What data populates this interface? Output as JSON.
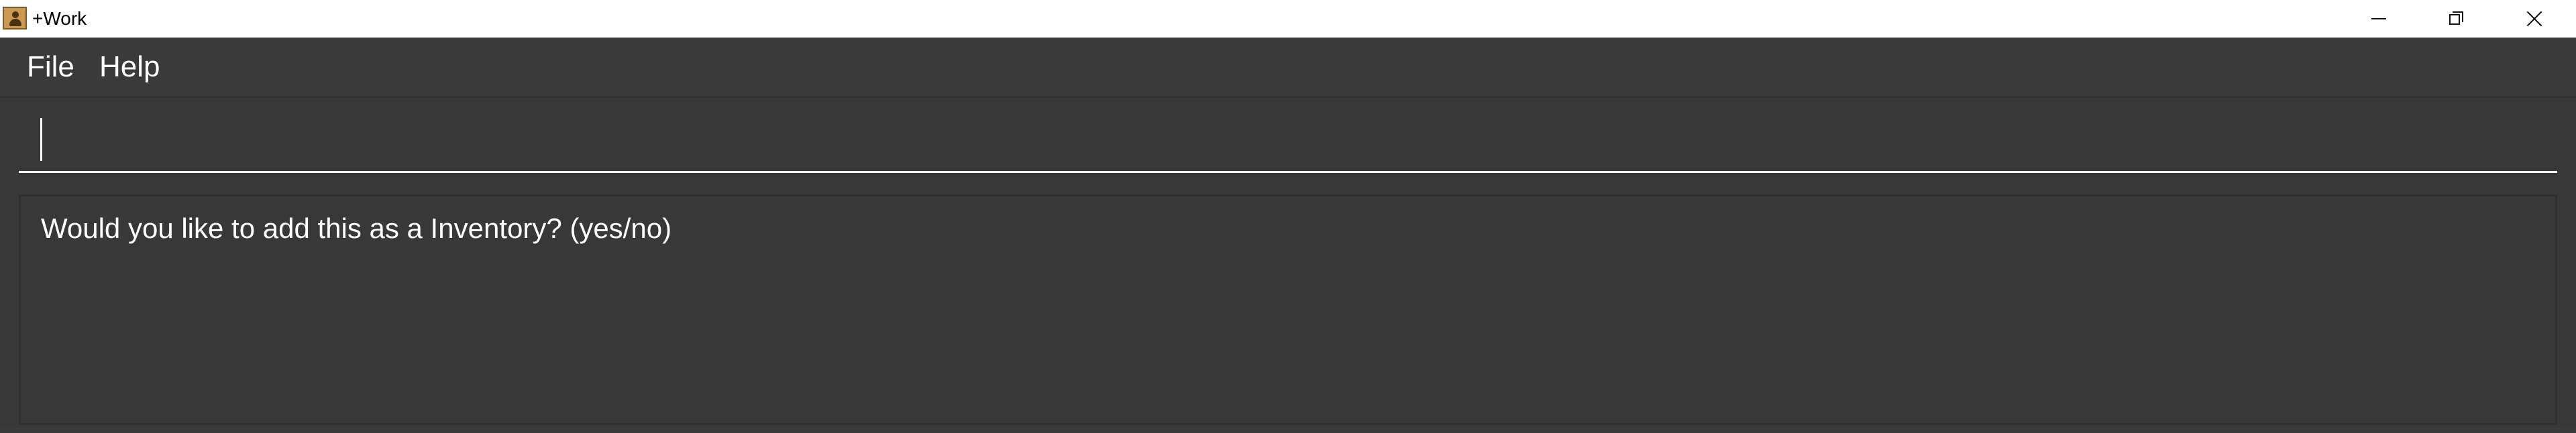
{
  "window": {
    "title": "+Work",
    "controls": {
      "minimize": "minimize-icon",
      "restore": "restore-icon",
      "close": "close-icon"
    }
  },
  "menu": {
    "items": [
      {
        "label": "File"
      },
      {
        "label": "Help"
      }
    ]
  },
  "command_box": {
    "value": "",
    "placeholder": ""
  },
  "result_display": {
    "text": "Would you like to add this as a Inventory? (yes/no)"
  },
  "colors": {
    "background": "#383838",
    "titlebar": "#ffffff",
    "text": "#ffffff"
  }
}
